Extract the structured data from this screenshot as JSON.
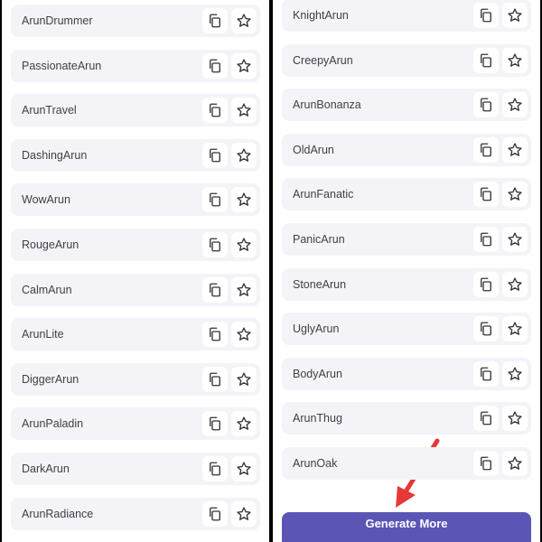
{
  "left_names": [
    "ArunDrummer",
    "PassionateArun",
    "ArunTravel",
    "DashingArun",
    "WowArun",
    "RougeArun",
    "CalmArun",
    "ArunLite",
    "DiggerArun",
    "ArunPaladin",
    "DarkArun",
    "ArunRadiance"
  ],
  "right_names": [
    "KnightArun",
    "CreepyArun",
    "ArunBonanza",
    "OldArun",
    "ArunFanatic",
    "PanicArun",
    "StoneArun",
    "UglyArun",
    "BodyArun",
    "ArunThug",
    "ArunOak"
  ],
  "generate_button": {
    "label": "Generate More"
  },
  "icons": {
    "copy": "copy-icon",
    "favorite": "star-icon"
  },
  "colors": {
    "row_background": "#f4f3f8",
    "button_background": "#5b55b6",
    "annotation_arrow": "#e53935"
  }
}
